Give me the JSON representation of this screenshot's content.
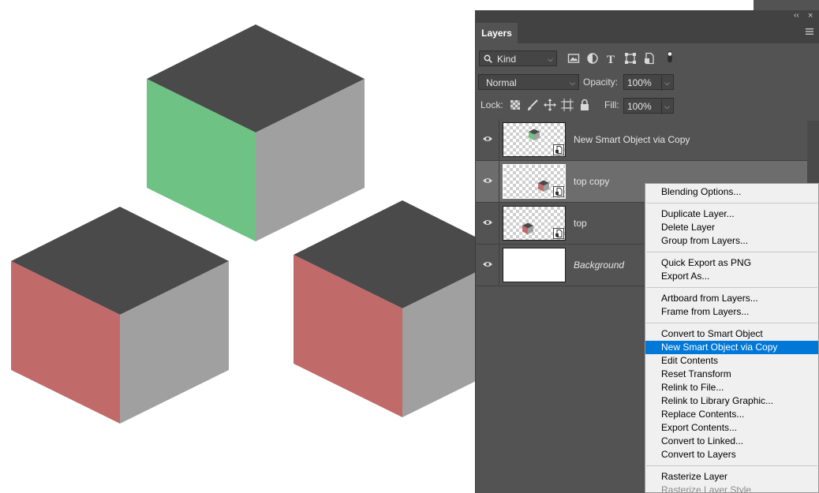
{
  "panel": {
    "tab_label": "Layers",
    "collapse_glyph": "‹‹",
    "close_glyph": "×",
    "filter": {
      "value": "Kind",
      "icons": [
        "image-filter-icon",
        "adjustment-filter-icon",
        "type-filter-icon",
        "shape-filter-icon",
        "smart-object-filter-icon",
        "filter-toggle-icon"
      ]
    },
    "blend_mode": "Normal",
    "opacity_label": "Opacity:",
    "opacity_value": "100%",
    "lock_label": "Lock:",
    "fill_label": "Fill:",
    "fill_value": "100%"
  },
  "layers": [
    {
      "name": "New Smart Object via Copy",
      "selected": false,
      "smart_object": true,
      "thumb_color": "#6ec284"
    },
    {
      "name": "top copy",
      "selected": true,
      "smart_object": true,
      "thumb_color": "#c06a6a"
    },
    {
      "name": "top",
      "selected": false,
      "smart_object": true,
      "thumb_color": "#c06a6a"
    },
    {
      "name": "Background",
      "selected": false,
      "smart_object": false,
      "italic": true
    }
  ],
  "context_menu": {
    "items": [
      "Blending Options...",
      "Duplicate Layer...",
      "Delete Layer",
      "Group from Layers...",
      "Quick Export as PNG",
      "Export As...",
      "Artboard from Layers...",
      "Frame from Layers...",
      "Convert to Smart Object",
      "New Smart Object via Copy",
      "Edit Contents",
      "Reset Transform",
      "Relink to File...",
      "Relink to Library Graphic...",
      "Replace Contents...",
      "Export Contents...",
      "Convert to Linked...",
      "Convert to Layers",
      "Rasterize Layer",
      "Rasterize Layer Style"
    ],
    "highlighted": "New Smart Object via Copy"
  },
  "colors": {
    "cube_top": "#4a4a4a",
    "cube_right": "#a0a0a0",
    "cube_green": "#6ec284",
    "cube_red": "#c06a6a",
    "panel_bg": "#535353",
    "menu_highlight": "#0078d7"
  }
}
